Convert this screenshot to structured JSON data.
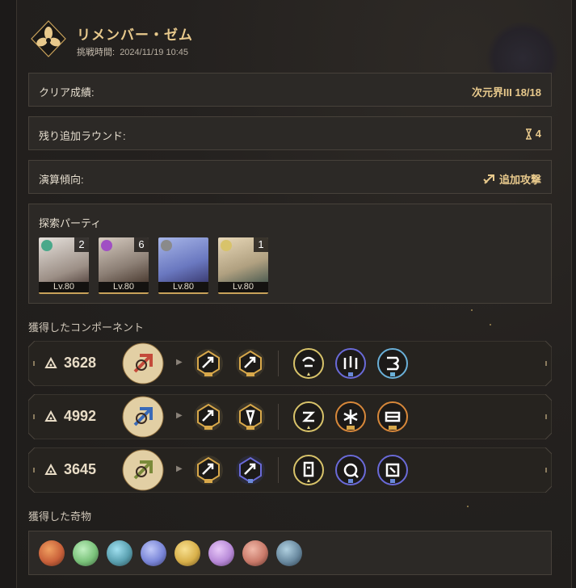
{
  "header": {
    "title": "リメンバー・ゼム",
    "challenge_time_label": "挑戦時間:",
    "challenge_time": "2024/11/19 10:45"
  },
  "stats": {
    "clear_label": "クリア成績:",
    "clear_value": "次元界III 18/18",
    "rounds_label": "残り追加ラウンド:",
    "rounds_value": "4",
    "tendency_label": "演算傾向:",
    "tendency_value": "追加攻撃"
  },
  "party": {
    "label": "探索パーティ",
    "members": [
      {
        "eidolon": "2",
        "level": "Lv.80",
        "element_color": "#4aa88a",
        "portrait_color": "#d8d2cc"
      },
      {
        "eidolon": "6",
        "level": "Lv.80",
        "element_color": "#a04fc4",
        "portrait_color": "#c9bcb0"
      },
      {
        "eidolon": "",
        "level": "Lv.80",
        "element_color": "#8a8a8a",
        "portrait_color": "#9aa6d6"
      },
      {
        "eidolon": "1",
        "level": "Lv.80",
        "element_color": "#d8c36a",
        "portrait_color": "#d9c9a8"
      }
    ]
  },
  "components": {
    "label": "獲得したコンポーネント",
    "items": [
      {
        "score": "3628",
        "main_color": "#c44a3a",
        "small": [
          "gold",
          "gold",
          "gold",
          "blue",
          "cyan"
        ]
      },
      {
        "score": "4992",
        "main_color": "#3a6ab8",
        "small": [
          "gold",
          "gold",
          "gold",
          "orange",
          "orange"
        ]
      },
      {
        "score": "3645",
        "main_color": "#7a8a3a",
        "small": [
          "gold",
          "blue",
          "gold",
          "blue",
          "blue"
        ]
      }
    ]
  },
  "relics": {
    "label": "獲得した奇物",
    "items": [
      {
        "color": "#c9613a"
      },
      {
        "color": "#7ac27a"
      },
      {
        "color": "#5aa0b0"
      },
      {
        "color": "#7a86d8"
      },
      {
        "color": "#d8b04a"
      },
      {
        "color": "#b88ad8"
      },
      {
        "color": "#c97a6a"
      },
      {
        "color": "#6a8aa0"
      }
    ]
  },
  "colors": {
    "accent": "#e8c98c",
    "panel": "#2c2926",
    "border": "#47413a"
  }
}
